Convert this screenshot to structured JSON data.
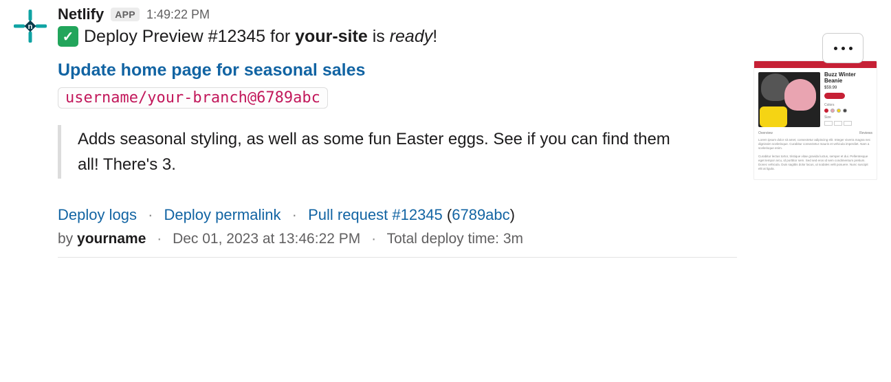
{
  "header": {
    "app_name": "Netlify",
    "app_badge": "APP",
    "timestamp": "1:49:22 PM"
  },
  "message": {
    "pre": "Deploy Preview ",
    "number": "#12345",
    "mid": " for ",
    "site": "your-site",
    "is_word": " is ",
    "status": "ready",
    "suffix": "!"
  },
  "attachment": {
    "title": "Update home page for seasonal sales",
    "branch_ref": "username/your-branch@6789abc",
    "description": "Adds seasonal styling, as well as some fun Easter eggs. See if you can find them all! There's 3."
  },
  "links": {
    "deploy_logs": "Deploy logs",
    "deploy_permalink": "Deploy permalink",
    "pull_request_label": "Pull request #12345",
    "commit_open": " (",
    "commit": "6789abc",
    "commit_close": ")"
  },
  "meta": {
    "by_label": "by ",
    "author": "yourname",
    "date": "Dec 01, 2023 at 13:46:22 PM",
    "deploy_time": "Total deploy time: 3m"
  },
  "thumb": {
    "title": "Buzz Winter Beanie",
    "price": "$59.99",
    "tab1": "Overview",
    "tab2": "Reviews"
  }
}
